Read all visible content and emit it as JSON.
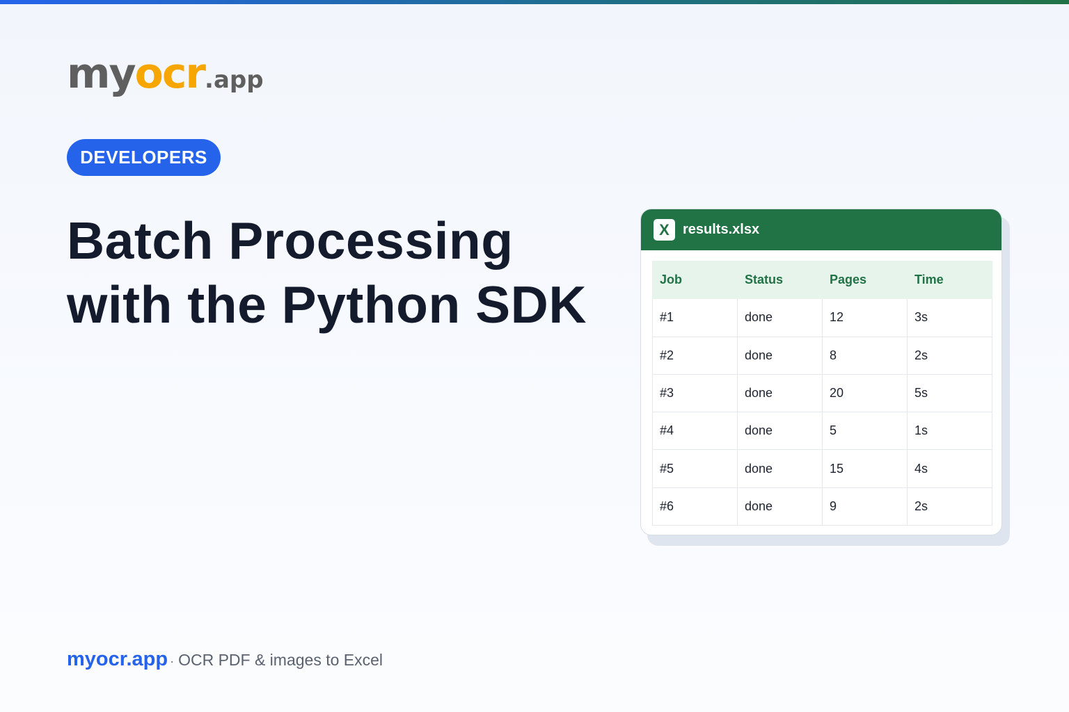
{
  "logo": {
    "part1": "my",
    "part2": "ocr",
    "part3": ".app"
  },
  "badge": {
    "label": "DEVELOPERS"
  },
  "headline": {
    "line1": "Batch Processing",
    "line2": "with the Python SDK"
  },
  "spreadsheet": {
    "icon_label": "X",
    "file_name": "results.xlsx",
    "columns": [
      "Job",
      "Status",
      "Pages",
      "Time"
    ],
    "rows": [
      [
        "#1",
        "done",
        "12",
        "3s"
      ],
      [
        "#2",
        "done",
        "8",
        "2s"
      ],
      [
        "#3",
        "done",
        "20",
        "5s"
      ],
      [
        "#4",
        "done",
        "5",
        "1s"
      ],
      [
        "#5",
        "done",
        "15",
        "4s"
      ],
      [
        "#6",
        "done",
        "9",
        "2s"
      ]
    ]
  },
  "footer": {
    "brand": "myocr.app",
    "separator": "·",
    "tagline": "OCR PDF & images to Excel"
  },
  "colors": {
    "accent_blue": "#2563eb",
    "excel_green": "#217346",
    "logo_gray": "#5f5f5f",
    "logo_orange": "#f7a600",
    "header_row_bg": "#e7f4ec",
    "headline_text": "#141b2d"
  },
  "icons": {
    "file_type": "excel-icon"
  }
}
